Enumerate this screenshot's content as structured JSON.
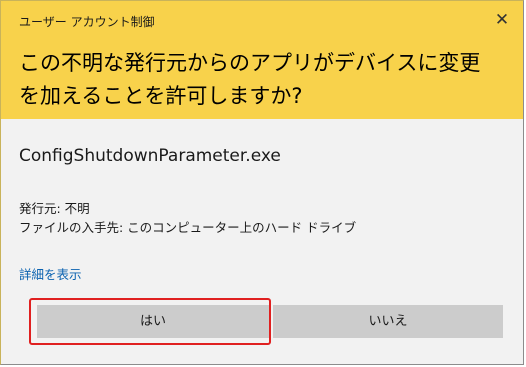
{
  "dialog": {
    "title": "ユーザー アカウント制御",
    "close_icon": "close-icon",
    "close_glyph": "✕",
    "question": "この不明な発行元からのアプリがデバイスに変更を加えることを許可しますか?",
    "header_color": "#f8d24b"
  },
  "details": {
    "program_name": "ConfigShutdownParameter.exe",
    "publisher_line": "発行元: 不明",
    "origin_line": "ファイルの入手先: このコンピューター上のハード ドライブ",
    "show_details_link": "詳細を表示"
  },
  "buttons": {
    "yes_label": "はい",
    "no_label": "いいえ"
  },
  "annotation": {
    "highlight_color": "#e02020"
  }
}
